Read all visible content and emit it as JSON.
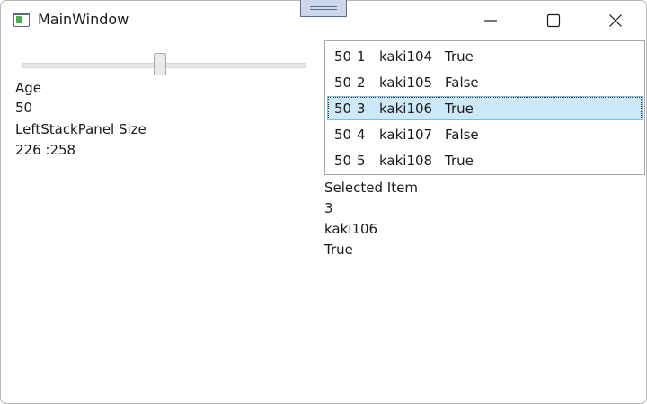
{
  "window": {
    "title": "MainWindow"
  },
  "left_panel": {
    "slider_value": 50,
    "age_label": "Age",
    "age_value": "50",
    "size_label": "LeftStackPanel Size",
    "size_value": "226 :258"
  },
  "list": {
    "rows": [
      {
        "age": "50",
        "id": "1",
        "name": "kaki104",
        "flag": "True"
      },
      {
        "age": "50",
        "id": "2",
        "name": "kaki105",
        "flag": "False"
      },
      {
        "age": "50",
        "id": "3",
        "name": "kaki106",
        "flag": "True"
      },
      {
        "age": "50",
        "id": "4",
        "name": "kaki107",
        "flag": "False"
      },
      {
        "age": "50",
        "id": "5",
        "name": "kaki108",
        "flag": "True"
      }
    ],
    "selected_index": 2
  },
  "selection": {
    "header": "Selected Item",
    "id": "3",
    "name": "kaki106",
    "flag": "True"
  },
  "colors": {
    "selection_bg": "#cde8f7",
    "slider_track": "#e6e6e6"
  }
}
